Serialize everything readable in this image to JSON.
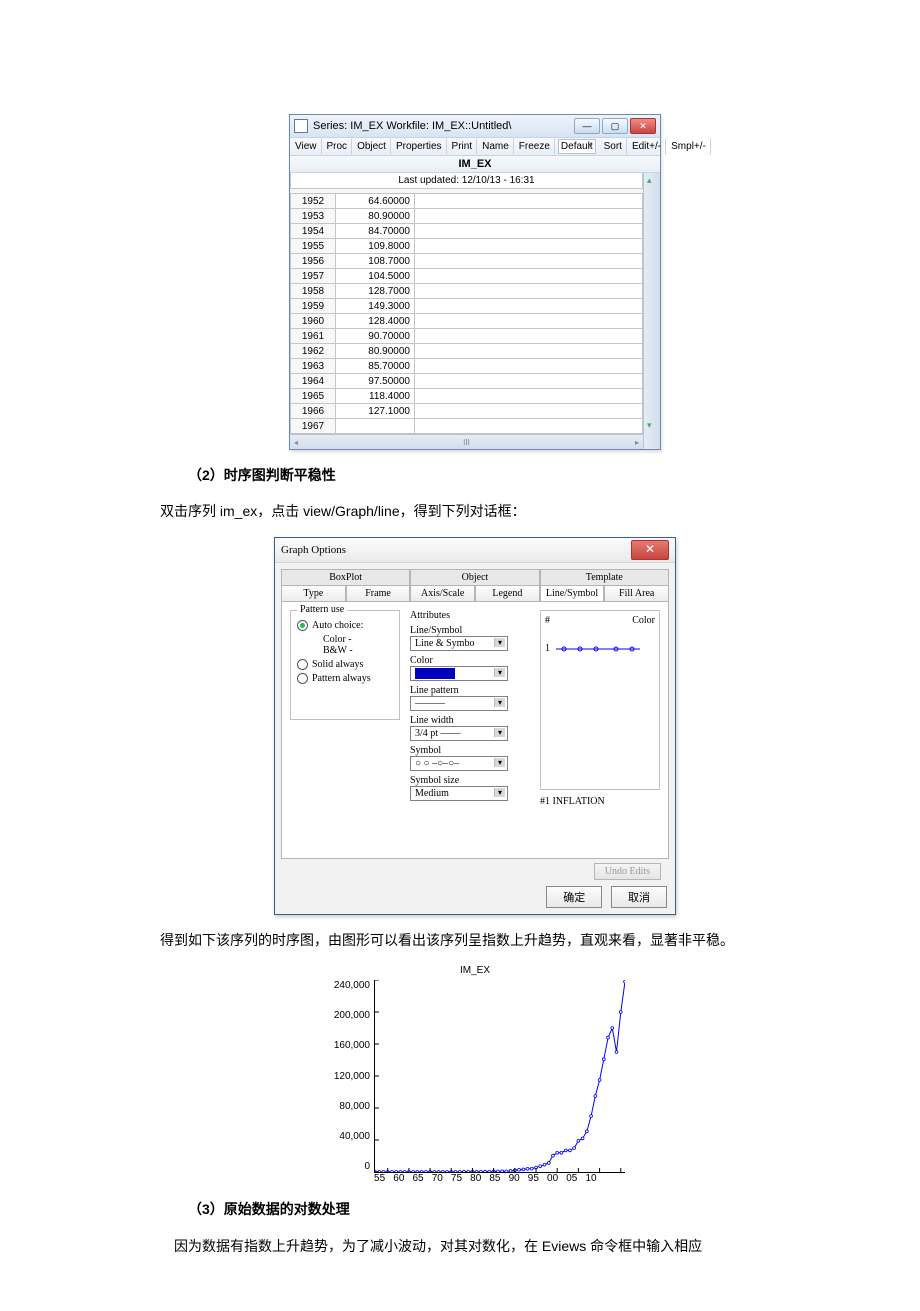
{
  "eviews_window": {
    "title": "Series: IM_EX   Workfile: IM_EX::Untitled\\",
    "toolbar_left": [
      "View",
      "Proc",
      "Object",
      "Properties"
    ],
    "toolbar_mid": [
      "Print",
      "Name",
      "Freeze"
    ],
    "dropdown_value": "Default",
    "toolbar_right": [
      "Sort",
      "Edit+/-",
      "Smpl+/-"
    ],
    "series_name": "IM_EX",
    "last_updated": "Last updated: 12/10/13 - 16:31",
    "rows": [
      {
        "year": "1952",
        "value": "64.60000"
      },
      {
        "year": "1953",
        "value": "80.90000"
      },
      {
        "year": "1954",
        "value": "84.70000"
      },
      {
        "year": "1955",
        "value": "109.8000"
      },
      {
        "year": "1956",
        "value": "108.7000"
      },
      {
        "year": "1957",
        "value": "104.5000"
      },
      {
        "year": "1958",
        "value": "128.7000"
      },
      {
        "year": "1959",
        "value": "149.3000"
      },
      {
        "year": "1960",
        "value": "128.4000"
      },
      {
        "year": "1961",
        "value": "90.70000"
      },
      {
        "year": "1962",
        "value": "80.90000"
      },
      {
        "year": "1963",
        "value": "85.70000"
      },
      {
        "year": "1964",
        "value": "97.50000"
      },
      {
        "year": "1965",
        "value": "118.4000"
      },
      {
        "year": "1966",
        "value": "127.1000"
      },
      {
        "year": "1967",
        "value": ""
      }
    ],
    "hscroll_thumb": "III"
  },
  "section2_heading": "（2）时序图判断平稳性",
  "section2_text": "双击序列 im_ex，点击 view/Graph/line，得到下列对话框：",
  "graph_options": {
    "title": "Graph Options",
    "tabs_back": [
      "BoxPlot",
      "Object",
      "Template"
    ],
    "tabs_front": [
      "Type",
      "Frame",
      "Axis/Scale",
      "Legend",
      "Line/Symbol",
      "Fill Area"
    ],
    "active_tab": "Line/Symbol",
    "pattern_use": {
      "title": "Pattern use",
      "options": [
        {
          "label": "Auto choice:",
          "sub": [
            "Color -",
            "B&W -"
          ],
          "selected": true
        },
        {
          "label": "Solid always",
          "selected": false
        },
        {
          "label": "Pattern always",
          "selected": false
        }
      ]
    },
    "attributes": {
      "title": "Attributes",
      "fields": {
        "line_symbol": {
          "label": "Line/Symbol",
          "value": "Line & Symbo"
        },
        "color": {
          "label": "Color"
        },
        "line_pattern": {
          "label": "Line pattern",
          "value": "———"
        },
        "line_width": {
          "label": "Line width",
          "value": "3/4 pt ——"
        },
        "symbol": {
          "label": "Symbol",
          "value": "○ ○ –○–○–"
        },
        "symbol_size": {
          "label": "Symbol size",
          "value": "Medium"
        }
      }
    },
    "preview": {
      "hash": "#",
      "color": "Color",
      "row": "1",
      "legend": "#1  INFLATION"
    },
    "undo": "Undo Edits",
    "ok": "确定",
    "cancel": "取消"
  },
  "chart_intro": "得到如下该序列的时序图，由图形可以看出该序列呈指数上升趋势，直观来看，显著非平稳。",
  "chart_data": {
    "type": "line",
    "title": "IM_EX",
    "ylabel": "",
    "ylim": [
      0,
      240000
    ],
    "yticks": [
      0,
      40000,
      80000,
      120000,
      160000,
      200000,
      240000
    ],
    "ytick_labels": [
      "0",
      "40,000",
      "80,000",
      "120,000",
      "160,000",
      "200,000",
      "240,000"
    ],
    "x": [
      55,
      60,
      65,
      70,
      75,
      80,
      85,
      90,
      95,
      100,
      105,
      110
    ],
    "xtick_labels": [
      "55",
      "60",
      "65",
      "70",
      "75",
      "80",
      "85",
      "90",
      "95",
      "00",
      "05",
      "10"
    ],
    "series": [
      {
        "name": "IM_EX",
        "color": "#0000ff",
        "x": [
          52,
          53,
          54,
          55,
          56,
          57,
          58,
          59,
          60,
          61,
          62,
          63,
          64,
          65,
          66,
          67,
          68,
          69,
          70,
          71,
          72,
          73,
          74,
          75,
          76,
          77,
          78,
          79,
          80,
          81,
          82,
          83,
          84,
          85,
          86,
          87,
          88,
          89,
          90,
          91,
          92,
          93,
          94,
          95,
          96,
          97,
          98,
          99,
          100,
          101,
          102,
          103,
          104,
          105,
          106,
          107,
          108,
          109,
          110,
          111
        ],
        "values": [
          65,
          81,
          85,
          110,
          109,
          105,
          129,
          149,
          128,
          91,
          81,
          86,
          98,
          118,
          127,
          120,
          120,
          120,
          120,
          130,
          160,
          220,
          300,
          300,
          280,
          290,
          370,
          470,
          590,
          760,
          800,
          880,
          1300,
          2200,
          2800,
          3200,
          4000,
          4200,
          5600,
          7300,
          9200,
          11300,
          20500,
          24000,
          24000,
          27000,
          27000,
          30000,
          39000,
          42000,
          51000,
          70000,
          95000,
          115000,
          141000,
          168000,
          180000,
          150000,
          200000,
          238000
        ]
      }
    ]
  },
  "section3_heading": "（3）原始数据的对数处理",
  "section3_text": "因为数据有指数上升趋势，为了减小波动，对其对数化，在 Eviews 命令框中输入相应"
}
